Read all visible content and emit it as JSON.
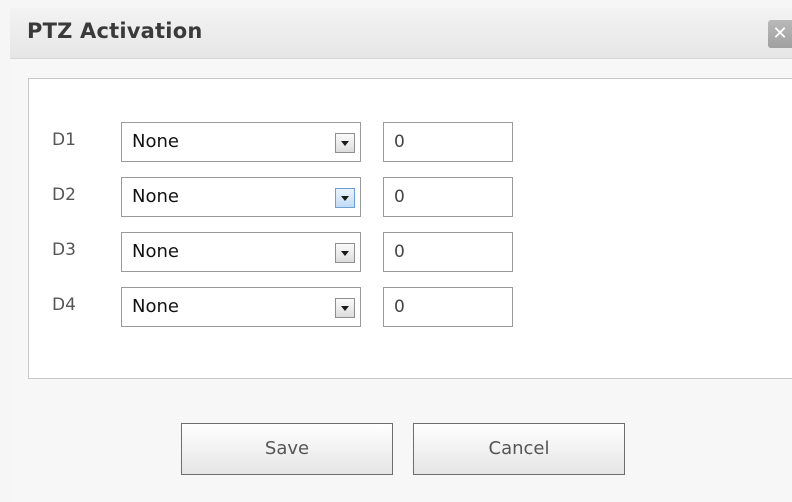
{
  "dialog": {
    "title": "PTZ Activation",
    "close_symbol": "✕"
  },
  "rows": [
    {
      "label": "D1",
      "select_value": "None",
      "input_value": "0"
    },
    {
      "label": "D2",
      "select_value": "None",
      "input_value": "0"
    },
    {
      "label": "D3",
      "select_value": "None",
      "input_value": "0"
    },
    {
      "label": "D4",
      "select_value": "None",
      "input_value": "0"
    }
  ],
  "buttons": {
    "save_label": "Save",
    "cancel_label": "Cancel"
  },
  "icons": {
    "close": "close-icon",
    "dropdown": "chevron-down-icon"
  },
  "colors": {
    "dropdown_active_accent": "#6f9fd6"
  }
}
